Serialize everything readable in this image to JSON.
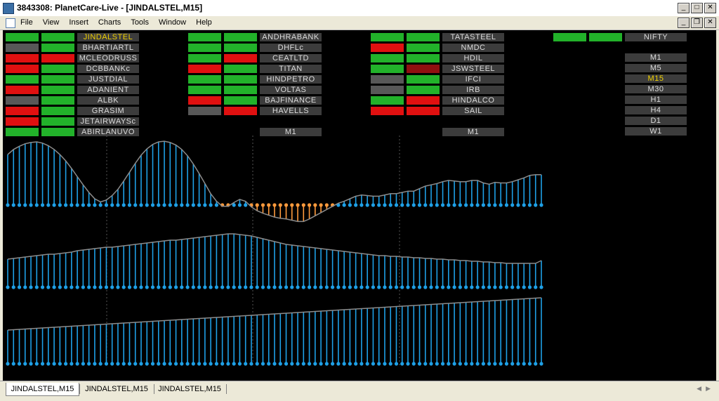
{
  "app": {
    "title": "3843308: PlanetCare-Live - [JINDALSTEL,M15]",
    "menu": [
      "File",
      "View",
      "Insert",
      "Charts",
      "Tools",
      "Window",
      "Help"
    ]
  },
  "colors": {
    "green": "#22b22a",
    "red": "#e01010",
    "gray": "#585858",
    "darkred": "#901010",
    "blue": "#1ea0e6",
    "orange": "#ff9a3c",
    "line": "#8c8c8c",
    "label_bg": "#3c3c3c",
    "selected": "#f0d000"
  },
  "matrix": {
    "groups": [
      {
        "rows": [
          {
            "name": "JINDALSTEL",
            "c1": "green",
            "c2": "green",
            "selected": true
          },
          {
            "name": "BHARTIARTL",
            "c1": "gray",
            "c2": "green"
          },
          {
            "name": "MCLEODRUSS",
            "c1": "red",
            "c2": "red"
          },
          {
            "name": "DCBBANKc",
            "c1": "red",
            "c2": "green"
          },
          {
            "name": "JUSTDIAL",
            "c1": "green",
            "c2": "green"
          },
          {
            "name": "ADANIENT",
            "c1": "red",
            "c2": "green"
          },
          {
            "name": "ALBK",
            "c1": "gray",
            "c2": "green"
          },
          {
            "name": "GRASIM",
            "c1": "red",
            "c2": "green"
          },
          {
            "name": "JETAIRWAYSc",
            "c1": "red",
            "c2": "green"
          },
          {
            "name": "ABIRLANUVO",
            "c1": "green",
            "c2": "green"
          }
        ]
      },
      {
        "rows": [
          {
            "name": "ANDHRABANK",
            "c1": "green",
            "c2": "green"
          },
          {
            "name": "DHFLc",
            "c1": "green",
            "c2": "green"
          },
          {
            "name": "CEATLTD",
            "c1": "green",
            "c2": "red"
          },
          {
            "name": "TITAN",
            "c1": "red",
            "c2": "green"
          },
          {
            "name": "HINDPETRO",
            "c1": "green",
            "c2": "green"
          },
          {
            "name": "VOLTAS",
            "c1": "green",
            "c2": "green"
          },
          {
            "name": "BAJFINANCE",
            "c1": "red",
            "c2": "green"
          },
          {
            "name": "HAVELLS",
            "c1": "gray",
            "c2": "red"
          }
        ],
        "footer": "M1"
      },
      {
        "rows": [
          {
            "name": "TATASTEEL",
            "c1": "green",
            "c2": "green"
          },
          {
            "name": "NMDC",
            "c1": "red",
            "c2": "green"
          },
          {
            "name": "HDIL",
            "c1": "green",
            "c2": "green"
          },
          {
            "name": "JSWSTEEL",
            "c1": "green",
            "c2": "darkred"
          },
          {
            "name": "IFCI",
            "c1": "gray",
            "c2": "green"
          },
          {
            "name": "IRB",
            "c1": "gray",
            "c2": "green"
          },
          {
            "name": "HINDALCO",
            "c1": "green",
            "c2": "red"
          },
          {
            "name": "SAIL",
            "c1": "red",
            "c2": "red"
          }
        ],
        "footer": "M1"
      },
      {
        "rows": [
          {
            "name": "NIFTY",
            "c1": "green",
            "c2": "green"
          }
        ]
      }
    ],
    "timeframes": [
      "M1",
      "M5",
      "M15",
      "M30",
      "H1",
      "H4",
      "D1",
      "W1"
    ],
    "selected_timeframe": "M15"
  },
  "chart_data": [
    {
      "type": "line",
      "name": "panel-1-oscillator",
      "y": [
        0.8,
        0.88,
        0.93,
        0.97,
        0.99,
        1.0,
        0.98,
        0.94,
        0.88,
        0.8,
        0.7,
        0.58,
        0.45,
        0.32,
        0.2,
        0.1,
        0.05,
        0.08,
        0.15,
        0.25,
        0.38,
        0.52,
        0.66,
        0.79,
        0.89,
        0.96,
        1.0,
        1.01,
        0.99,
        0.95,
        0.88,
        0.78,
        0.65,
        0.5,
        0.34,
        0.18,
        0.06,
        -0.02,
        -0.02,
        0.04,
        0.09,
        0.06,
        -0.03,
        -0.09,
        -0.13,
        -0.16,
        -0.19,
        -0.21,
        -0.22,
        -0.24,
        -0.26,
        -0.26,
        -0.22,
        -0.17,
        -0.12,
        -0.07,
        -0.02,
        0.03,
        0.06,
        0.1,
        0.14,
        0.16,
        0.15,
        0.14,
        0.14,
        0.16,
        0.18,
        0.18,
        0.2,
        0.22,
        0.22,
        0.26,
        0.3,
        0.32,
        0.34,
        0.37,
        0.39,
        0.38,
        0.37,
        0.37,
        0.39,
        0.39,
        0.35,
        0.33,
        0.36,
        0.35,
        0.35,
        0.37,
        0.4,
        0.43,
        0.47,
        0.48,
        0.48
      ],
      "zero_baseline": true
    },
    {
      "type": "line",
      "name": "panel-2-oscillator",
      "y": [
        0.4,
        0.41,
        0.42,
        0.43,
        0.44,
        0.45,
        0.46,
        0.47,
        0.47,
        0.48,
        0.49,
        0.5,
        0.52,
        0.53,
        0.54,
        0.55,
        0.56,
        0.57,
        0.57,
        0.58,
        0.59,
        0.6,
        0.61,
        0.62,
        0.63,
        0.64,
        0.65,
        0.66,
        0.67,
        0.67,
        0.68,
        0.69,
        0.7,
        0.71,
        0.72,
        0.73,
        0.74,
        0.75,
        0.76,
        0.76,
        0.75,
        0.74,
        0.73,
        0.71,
        0.69,
        0.67,
        0.65,
        0.63,
        0.61,
        0.6,
        0.59,
        0.58,
        0.57,
        0.56,
        0.55,
        0.54,
        0.53,
        0.52,
        0.51,
        0.5,
        0.49,
        0.48,
        0.47,
        0.46,
        0.45,
        0.45,
        0.44,
        0.44,
        0.43,
        0.43,
        0.42,
        0.42,
        0.41,
        0.41,
        0.4,
        0.4,
        0.39,
        0.39,
        0.38,
        0.38,
        0.37,
        0.37,
        0.36,
        0.36,
        0.35,
        0.35,
        0.34,
        0.34,
        0.34,
        0.34,
        0.34,
        0.34,
        0.38
      ]
    },
    {
      "type": "line",
      "name": "panel-3-oscillator",
      "y": [
        0.48,
        0.485,
        0.49,
        0.495,
        0.5,
        0.505,
        0.51,
        0.515,
        0.52,
        0.525,
        0.53,
        0.535,
        0.54,
        0.545,
        0.55,
        0.555,
        0.56,
        0.565,
        0.57,
        0.575,
        0.58,
        0.585,
        0.59,
        0.595,
        0.6,
        0.605,
        0.61,
        0.615,
        0.62,
        0.625,
        0.63,
        0.635,
        0.64,
        0.645,
        0.65,
        0.655,
        0.66,
        0.665,
        0.67,
        0.675,
        0.68,
        0.685,
        0.69,
        0.695,
        0.7,
        0.705,
        0.71,
        0.715,
        0.72,
        0.725,
        0.73,
        0.735,
        0.74,
        0.745,
        0.75,
        0.755,
        0.76,
        0.765,
        0.77,
        0.775,
        0.78,
        0.785,
        0.79,
        0.795,
        0.8,
        0.805,
        0.81,
        0.815,
        0.82,
        0.825,
        0.83,
        0.835,
        0.84,
        0.845,
        0.85,
        0.855,
        0.86,
        0.865,
        0.87,
        0.875,
        0.88,
        0.885,
        0.89,
        0.895,
        0.9,
        0.905,
        0.91,
        0.915,
        0.92,
        0.925,
        0.93,
        0.935,
        0.94
      ]
    }
  ],
  "tabs": [
    {
      "label": "JINDALSTEL,M15",
      "active": true
    },
    {
      "label": "JINDALSTEL,M15",
      "active": false
    },
    {
      "label": "JINDALSTEL,M15",
      "active": false
    }
  ]
}
